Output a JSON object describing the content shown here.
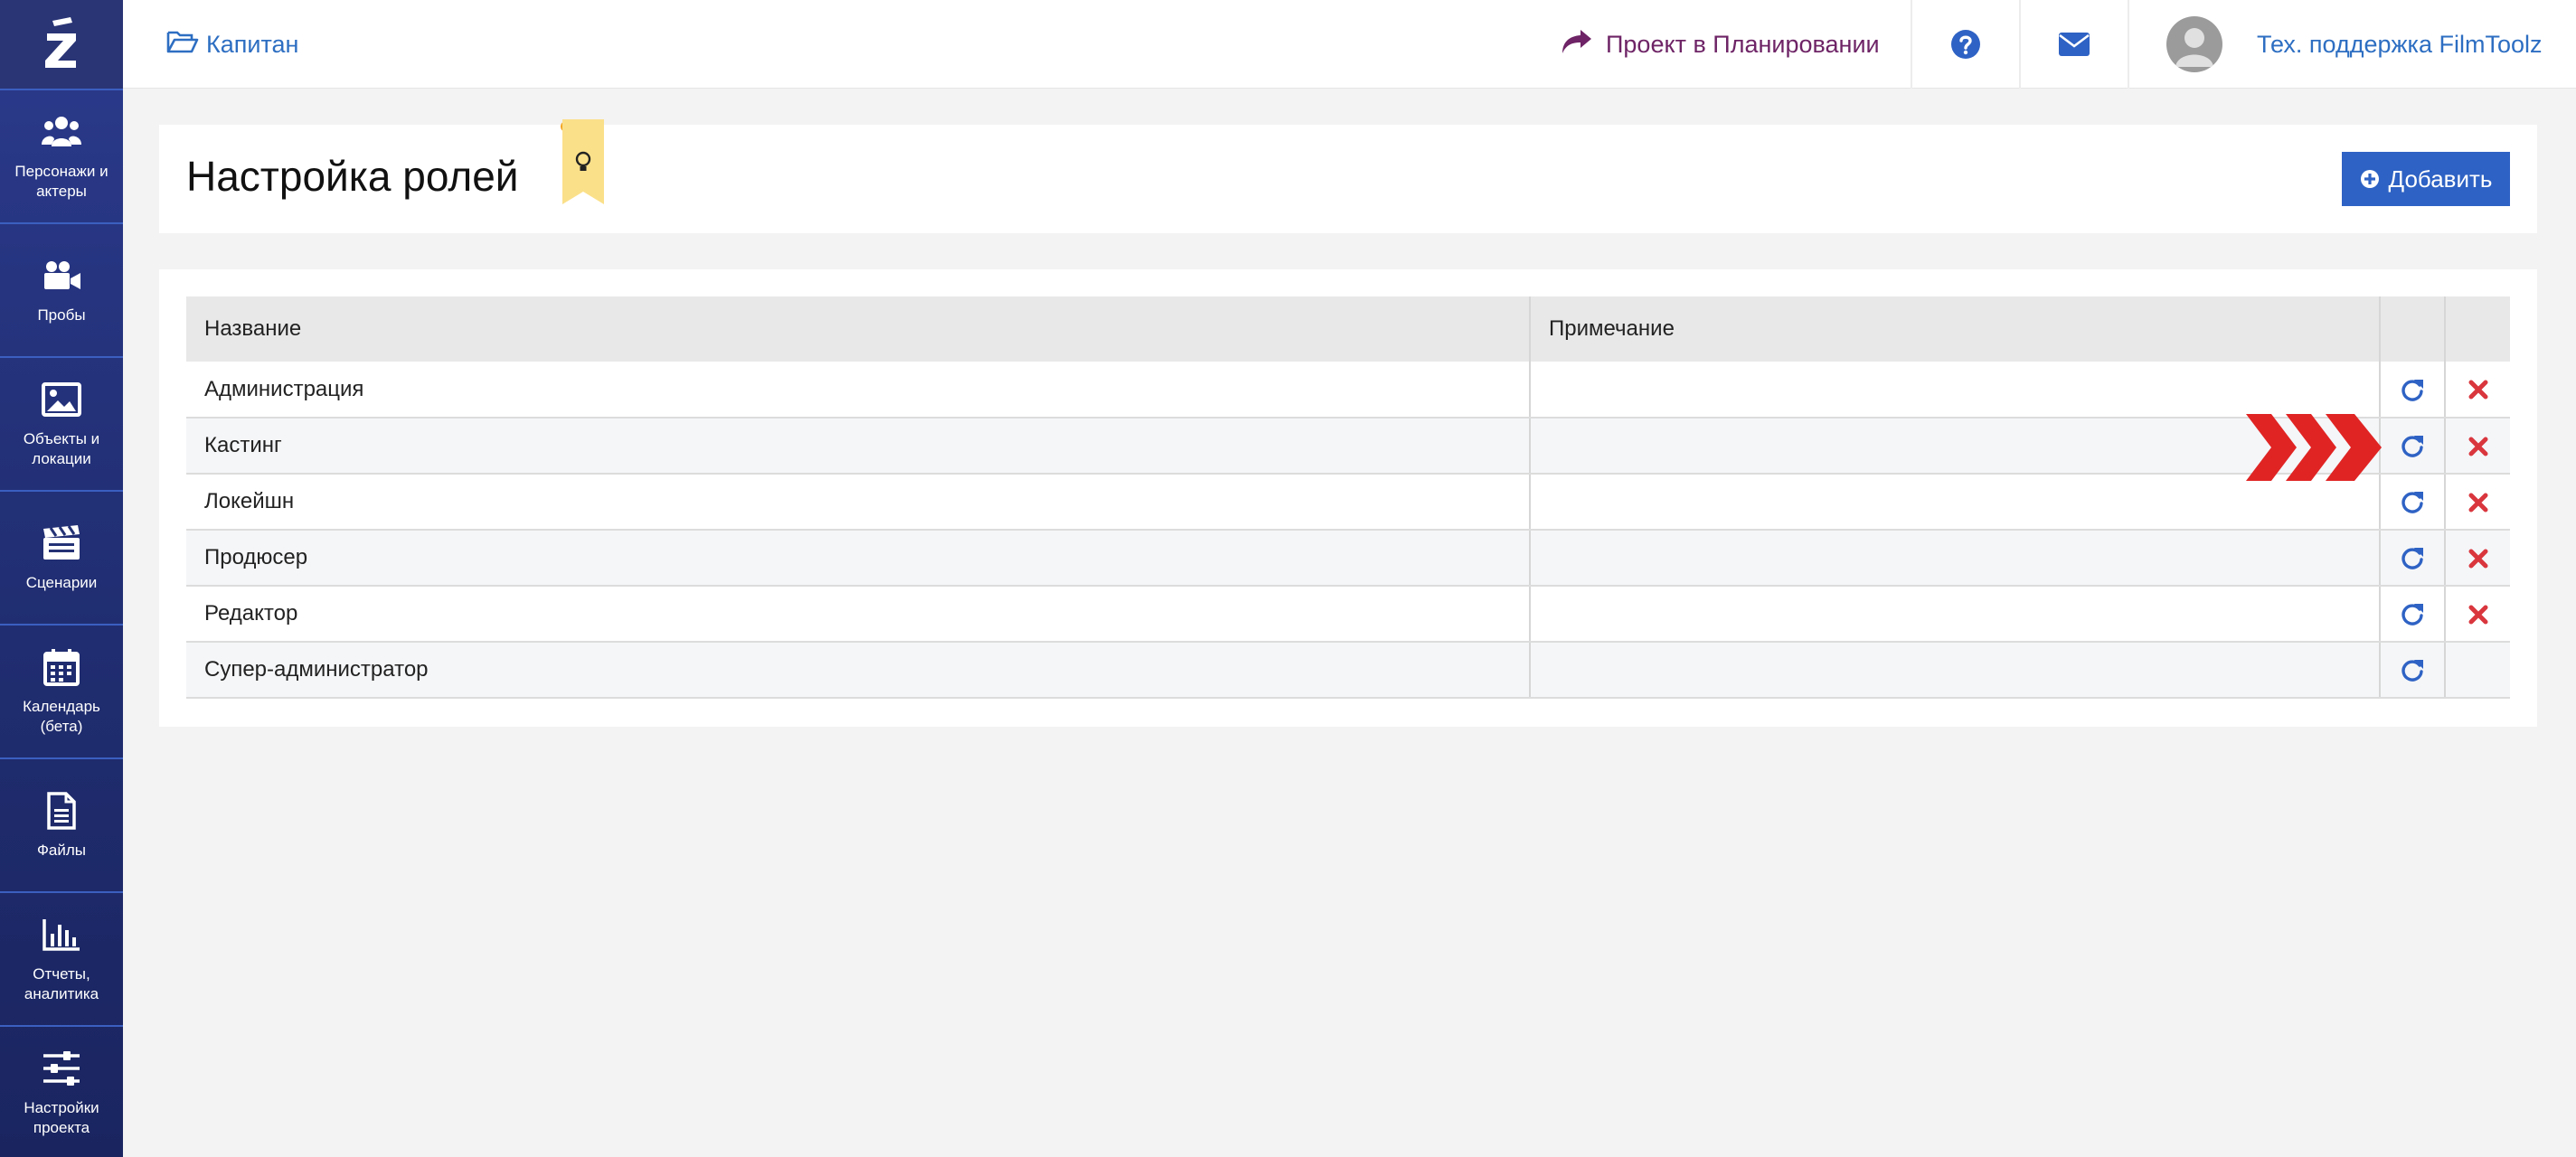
{
  "sidebar": {
    "items": [
      {
        "label": "Персонажи и актеры",
        "icon": "users-icon"
      },
      {
        "label": "Пробы",
        "icon": "video-camera-icon"
      },
      {
        "label": "Объекты и локации",
        "icon": "image-icon"
      },
      {
        "label": "Сценарии",
        "icon": "clapperboard-icon"
      },
      {
        "label": "Календарь (бета)",
        "icon": "calendar-icon"
      },
      {
        "label": "Файлы",
        "icon": "file-icon"
      },
      {
        "label": "Отчеты, аналитика",
        "icon": "bar-chart-icon"
      },
      {
        "label": "Настройки проекта",
        "icon": "sliders-icon"
      }
    ]
  },
  "topbar": {
    "breadcrumb": "Капитан",
    "project_status": "Проект в Планировании",
    "user_name": "Тех. поддержка FilmToolz"
  },
  "header": {
    "title": "Настройка ролей",
    "add_button": "Добавить"
  },
  "table": {
    "columns": [
      "Название",
      "Примечание",
      "",
      ""
    ],
    "rows": [
      {
        "name": "Администрация",
        "note": "",
        "deletable": true,
        "highlight": false
      },
      {
        "name": "Кастинг",
        "note": "",
        "deletable": true,
        "highlight": false
      },
      {
        "name": "Локейшн",
        "note": "",
        "deletable": true,
        "highlight": false
      },
      {
        "name": "Продюсер",
        "note": "",
        "deletable": true,
        "highlight": false
      },
      {
        "name": "Редактор",
        "note": "",
        "deletable": true,
        "highlight": false
      },
      {
        "name": "Супер-администратор",
        "note": "",
        "deletable": false,
        "highlight": true
      }
    ]
  },
  "colors": {
    "sidebar_bg": "#243275",
    "link_blue": "#2d6ec2",
    "status_purple": "#6e2466",
    "primary_button": "#2e62c4",
    "delete_red": "#d9363e",
    "highlight_red": "#e02020",
    "hint_yellow": "#fbe08a"
  }
}
